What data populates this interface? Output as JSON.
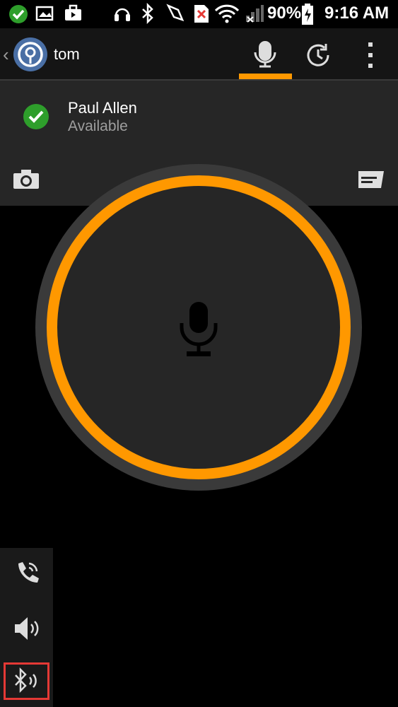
{
  "status_bar": {
    "battery": "90%",
    "time": "9:16 AM"
  },
  "action_bar": {
    "title": "tom",
    "tabs": [
      {
        "icon": "microphone-icon",
        "selected": true
      },
      {
        "icon": "history-icon",
        "selected": false
      }
    ],
    "menu_icon": "overflow-menu-icon"
  },
  "contact": {
    "name": "Paul Allen",
    "status": "Available"
  },
  "ptt_button": {
    "icon": "microphone-icon"
  },
  "audio_routes": [
    {
      "icon": "phone-handset-icon"
    },
    {
      "icon": "speaker-icon"
    },
    {
      "icon": "bluetooth-audio-icon",
      "highlighted": true
    }
  ],
  "colors": {
    "accent": "#ff9800",
    "available": "#2e9e2b",
    "panel": "#262626",
    "highlight": "#e53935"
  }
}
